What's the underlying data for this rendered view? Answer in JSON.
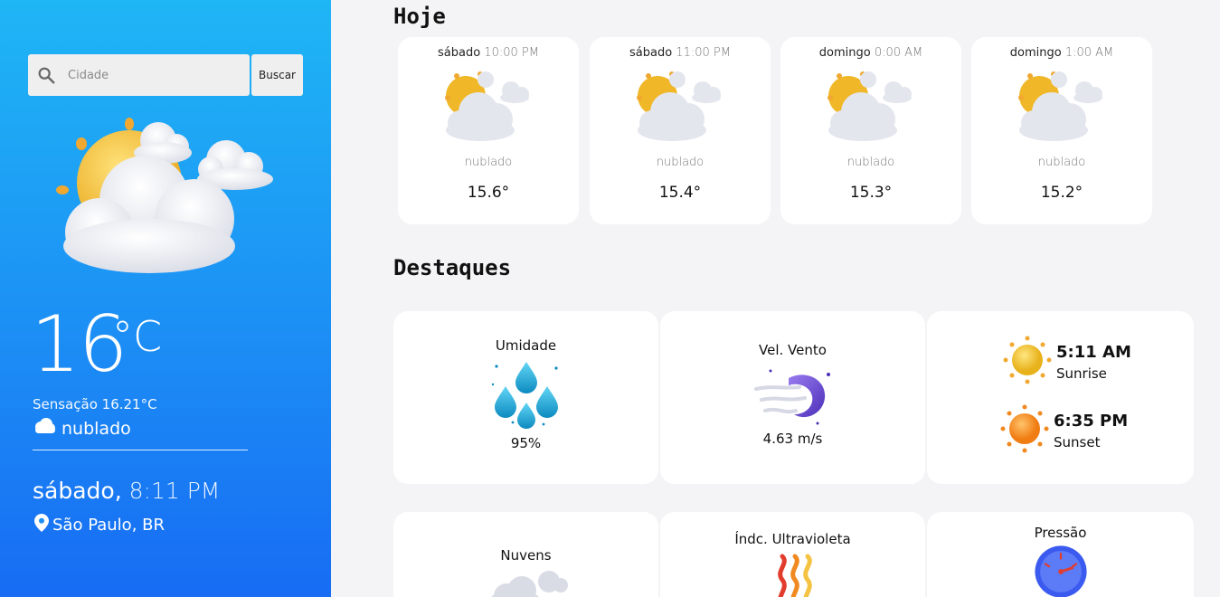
{
  "search": {
    "placeholder": "Cidade",
    "button_label": "Buscar"
  },
  "current": {
    "temp": "16",
    "unit": "°C",
    "feels_like": "Sensação 16.21°C",
    "condition": "nublado",
    "day": "sábado,",
    "time": "8:11 PM",
    "location": "São Paulo, BR"
  },
  "today": {
    "title": "Hoje",
    "forecast": [
      {
        "day": "sábado",
        "hour": "10:00 PM",
        "desc": "nublado",
        "temp": "15.6°"
      },
      {
        "day": "sábado",
        "hour": "11:00 PM",
        "desc": "nublado",
        "temp": "15.4°"
      },
      {
        "day": "domingo",
        "hour": "0:00 AM",
        "desc": "nublado",
        "temp": "15.3°"
      },
      {
        "day": "domingo",
        "hour": "1:00 AM",
        "desc": "nublado",
        "temp": "15.2°"
      }
    ]
  },
  "highlights": {
    "title": "Destaques",
    "humidity": {
      "label": "Umidade",
      "value": "95%"
    },
    "wind": {
      "label": "Vel. Vento",
      "value": "4.63 m/s"
    },
    "sunrise": {
      "time": "5:11 AM",
      "label": "Sunrise"
    },
    "sunset": {
      "time": "6:35 PM",
      "label": "Sunset"
    },
    "clouds": {
      "label": "Nuvens"
    },
    "uv": {
      "label": "Índc. Ultravioleta"
    },
    "pressure": {
      "label": "Pressão"
    }
  },
  "colors": {
    "sidebar_top": "#1fb6f5",
    "sidebar_bottom": "#176cf3",
    "background": "#f4f4f6"
  }
}
